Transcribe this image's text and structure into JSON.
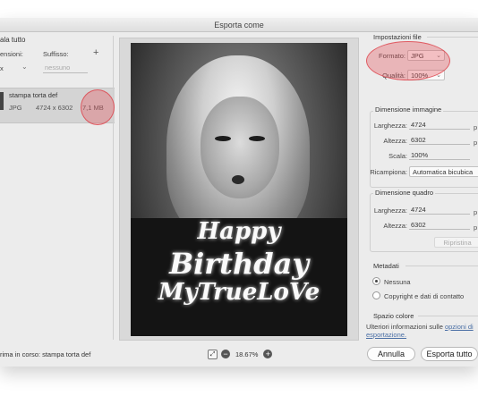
{
  "window": {
    "title": "Esporta come"
  },
  "left": {
    "scale_all": "ala tutto",
    "dimensions_label": "ensioni:",
    "suffix_label": "Suffisso:",
    "add_symbol": "+",
    "scale_value": "x",
    "suffix_placeholder": "nessuno",
    "asset": {
      "name": "stampa torta def",
      "format": "JPG",
      "dimensions": "4724 x 6302",
      "size": "7,1 MB"
    }
  },
  "preview": {
    "overlay_text": [
      "Happy",
      "Birthday",
      "MyTrueLoVe"
    ],
    "zoom": "18.67%"
  },
  "file_settings": {
    "title": "Impostazioni file",
    "format_label": "Formato:",
    "format_value": "JPG",
    "quality_label": "Qualità:",
    "quality_value": "100%"
  },
  "image_size": {
    "title": "Dimensione immagine",
    "width_label": "Larghezza:",
    "width_value": "4724",
    "height_label": "Altezza:",
    "height_value": "6302",
    "scale_label": "Scala:",
    "scale_value": "100%",
    "resample_label": "Ricampiona:",
    "resample_value": "Automatica bicubica",
    "unit": "p"
  },
  "canvas_size": {
    "title": "Dimensione quadro",
    "width_label": "Larghezza:",
    "width_value": "4724",
    "height_label": "Altezza:",
    "height_value": "6302",
    "reset_label": "Ripristina",
    "unit": "p"
  },
  "metadata": {
    "title": "Metadati",
    "option_none": "Nessuna",
    "option_copyright": "Copyright e dati di contatto"
  },
  "color_space": {
    "title": "Spazio colore",
    "info_prefix": "Ulteriori informazioni sulle",
    "info_link": "opzioni di esportazione."
  },
  "footer": {
    "status": "rima in corso: stampa torta def",
    "cancel_label": "Annulla",
    "export_label": "Esporta tutto"
  },
  "colors": {
    "highlight": "#e6505a",
    "window_bg": "#ececec"
  }
}
